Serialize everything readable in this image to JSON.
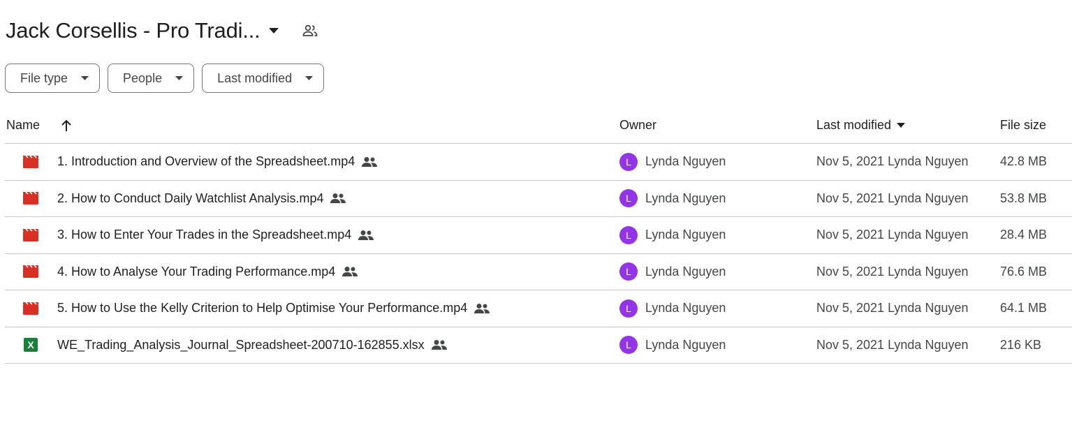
{
  "header": {
    "folder_title": "Jack Corsellis - Pro Tradi...",
    "caret_icon": "arrow-drop-down-icon",
    "shared_icon": "people-outline-icon"
  },
  "filters": [
    {
      "label": "File type"
    },
    {
      "label": "People"
    },
    {
      "label": "Last modified"
    }
  ],
  "table": {
    "columns": {
      "name": "Name",
      "owner": "Owner",
      "modified": "Last modified",
      "size": "File size"
    },
    "rows": [
      {
        "type": "video",
        "name": "1. Introduction and Overview of the Spreadsheet.mp4",
        "owner_initial": "L",
        "owner": "Lynda Nguyen",
        "modified": "Nov 5, 2021 Lynda Nguyen",
        "size": "42.8 MB"
      },
      {
        "type": "video",
        "name": "2. How to Conduct Daily Watchlist Analysis.mp4",
        "owner_initial": "L",
        "owner": "Lynda Nguyen",
        "modified": "Nov 5, 2021 Lynda Nguyen",
        "size": "53.8 MB"
      },
      {
        "type": "video",
        "name": "3. How to Enter Your Trades in the Spreadsheet.mp4",
        "owner_initial": "L",
        "owner": "Lynda Nguyen",
        "modified": "Nov 5, 2021 Lynda Nguyen",
        "size": "28.4 MB"
      },
      {
        "type": "video",
        "name": "4. How to Analyse Your Trading Performance.mp4",
        "owner_initial": "L",
        "owner": "Lynda Nguyen",
        "modified": "Nov 5, 2021 Lynda Nguyen",
        "size": "76.6 MB"
      },
      {
        "type": "video",
        "name": "5. How to Use the Kelly Criterion to Help Optimise Your Performance.mp4",
        "owner_initial": "L",
        "owner": "Lynda Nguyen",
        "modified": "Nov 5, 2021 Lynda Nguyen",
        "size": "64.1 MB"
      },
      {
        "type": "spreadsheet",
        "name": "WE_Trading_Analysis_Journal_Spreadsheet-200710-162855.xlsx",
        "icon_letter": "X",
        "owner_initial": "L",
        "owner": "Lynda Nguyen",
        "modified": "Nov 5, 2021 Lynda Nguyen",
        "size": "216 KB"
      }
    ]
  },
  "colors": {
    "video_icon": "#d93025",
    "spreadsheet_icon": "#188038",
    "avatar": "#9334e6",
    "divider": "#c7c7c7"
  }
}
